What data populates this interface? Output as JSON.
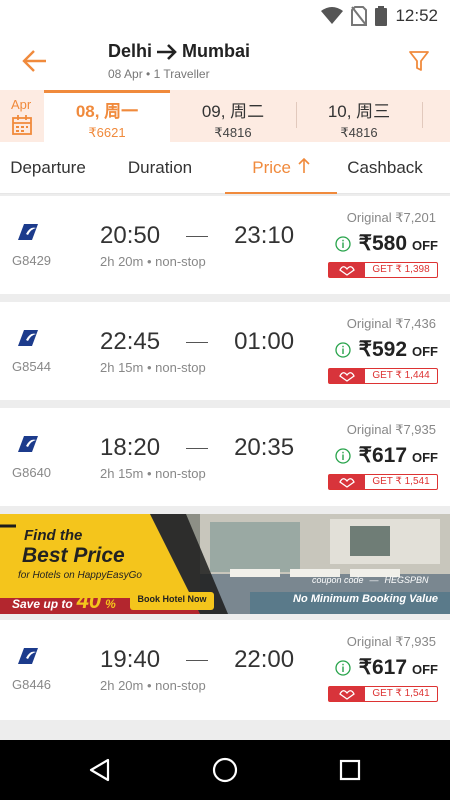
{
  "status": {
    "time": "12:52"
  },
  "header": {
    "from": "Delhi",
    "to": "Mumbai",
    "subtitle": "08 Apr • 1 Traveller"
  },
  "date_bar": {
    "month": "Apr",
    "dates": [
      {
        "day": "08, 周一",
        "price": "₹6621"
      },
      {
        "day": "09, 周二",
        "price": "₹4816"
      },
      {
        "day": "10, 周三",
        "price": "₹4816"
      }
    ]
  },
  "sort": {
    "tabs": [
      "Departure",
      "Duration",
      "Price",
      "Cashback"
    ],
    "active": "Price"
  },
  "flights": [
    {
      "flight_no": "G8429",
      "dep": "20:50",
      "arr": "23:10",
      "meta": "2h 20m • non-stop",
      "original": "Original ₹7,201",
      "price": "₹580",
      "off": "OFF",
      "cashback": "GET ₹ 1,398"
    },
    {
      "flight_no": "G8544",
      "dep": "22:45",
      "arr": "01:00",
      "meta": "2h 15m • non-stop",
      "original": "Original ₹7,436",
      "price": "₹592",
      "off": "OFF",
      "cashback": "GET ₹ 1,444"
    },
    {
      "flight_no": "G8640",
      "dep": "18:20",
      "arr": "20:35",
      "meta": "2h 15m • non-stop",
      "original": "Original ₹7,935",
      "price": "₹617",
      "off": "OFF",
      "cashback": "GET ₹ 1,541"
    },
    {
      "flight_no": "G8446",
      "dep": "19:40",
      "arr": "22:00",
      "meta": "2h 20m • non-stop",
      "original": "Original ₹7,935",
      "price": "₹617",
      "off": "OFF",
      "cashback": "GET ₹ 1,541"
    }
  ],
  "banner": {
    "line1": "Find the",
    "line2": "Best Price",
    "line3": "for Hotels on HappyEasyGo",
    "save": "Save up to",
    "save_pct": "40",
    "save_unit": "%",
    "cta": "Book Hotel Now",
    "coupon_label": "coupon code",
    "coupon_code": "HEGSPBN",
    "tagline": "No Minimum Booking  Value"
  },
  "colors": {
    "accent": "#f08a3c",
    "cashback_red": "#d8343b",
    "banner_yellow": "#f4c51c"
  }
}
